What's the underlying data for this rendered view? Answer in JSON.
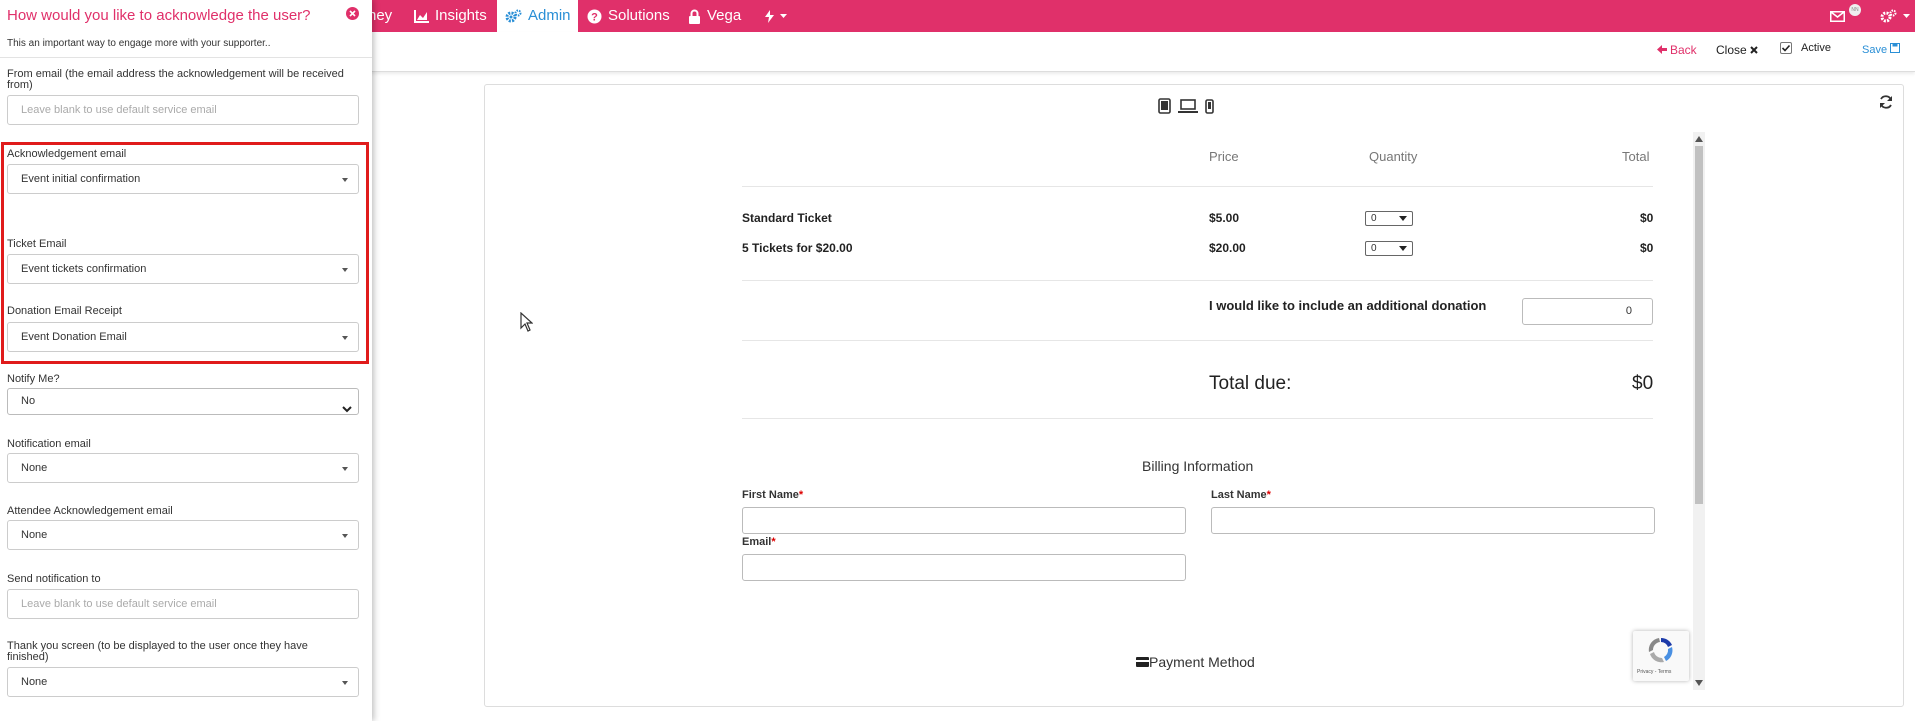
{
  "nav": {
    "items": [
      {
        "label": "ney",
        "icon": "none"
      },
      {
        "label": "Insights",
        "icon": "chart-icon"
      },
      {
        "label": "Admin",
        "icon": "gears-icon",
        "active": true
      },
      {
        "label": "Solutions",
        "icon": "question-icon"
      },
      {
        "label": "Vega",
        "icon": "lock-icon"
      }
    ],
    "badge": "NN"
  },
  "toolbar": {
    "back": "Back",
    "close": "Close",
    "active": "Active",
    "save": "Save",
    "active_checked": true
  },
  "form": {
    "price_header": "Price",
    "quantity_header": "Quantity",
    "total_header": "Total",
    "tickets": [
      {
        "name": "Standard Ticket",
        "price": "$5.00",
        "qty": "0",
        "total": "$0"
      },
      {
        "name": "5 Tickets for $20.00",
        "price": "$20.00",
        "qty": "0",
        "total": "$0"
      }
    ],
    "donation_label": "I would like to include an additional donation",
    "donation_value": "0",
    "total_due_label": "Total due:",
    "total_due_value": "$0",
    "billing_title": "Billing Information",
    "first_name": "First Name",
    "last_name": "Last Name",
    "email": "Email",
    "required": "*",
    "payment_method": "Payment Method",
    "recaptcha_text": "Privacy - Terms"
  },
  "panel": {
    "title": "How would you like to acknowledge the user?",
    "subtitle": "This an important way to engage more with your supporter..",
    "from_email_label": "From email (the email address the acknowledgement will be received from)",
    "from_email_placeholder": "Leave blank to use default service email",
    "ack_email_label": "Acknowledgement email",
    "ack_email_value": "Event initial confirmation",
    "ticket_email_label": "Ticket Email",
    "ticket_email_value": "Event tickets confirmation",
    "donation_email_label": "Donation Email Receipt",
    "donation_email_value": "Event Donation Email",
    "notify_label": "Notify Me?",
    "notify_value": "No",
    "notification_email_label": "Notification email",
    "notification_email_value": "None",
    "attendee_label": "Attendee Acknowledgement email",
    "attendee_value": "None",
    "send_to_label": "Send notification to",
    "send_to_placeholder": "Leave blank to use default service email",
    "thankyou_label": "Thank you screen (to be displayed to the user once they have finished)",
    "thankyou_value": "None"
  },
  "colors": {
    "brand": "#e0306a",
    "accent": "#2a8fd6",
    "highlight": "#e01b1b"
  }
}
